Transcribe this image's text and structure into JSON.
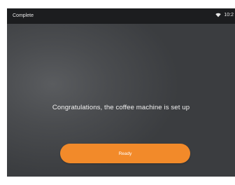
{
  "status_bar": {
    "title": "Complete",
    "time": "10:2",
    "wifi_icon": "wifi-icon"
  },
  "main": {
    "message": "Congratulations, the coffee machine is set up",
    "ready_label": "Ready"
  },
  "colors": {
    "accent": "#f28a2a",
    "status_bar_bg": "#1c1d1f",
    "background": "#4a4c4f"
  }
}
